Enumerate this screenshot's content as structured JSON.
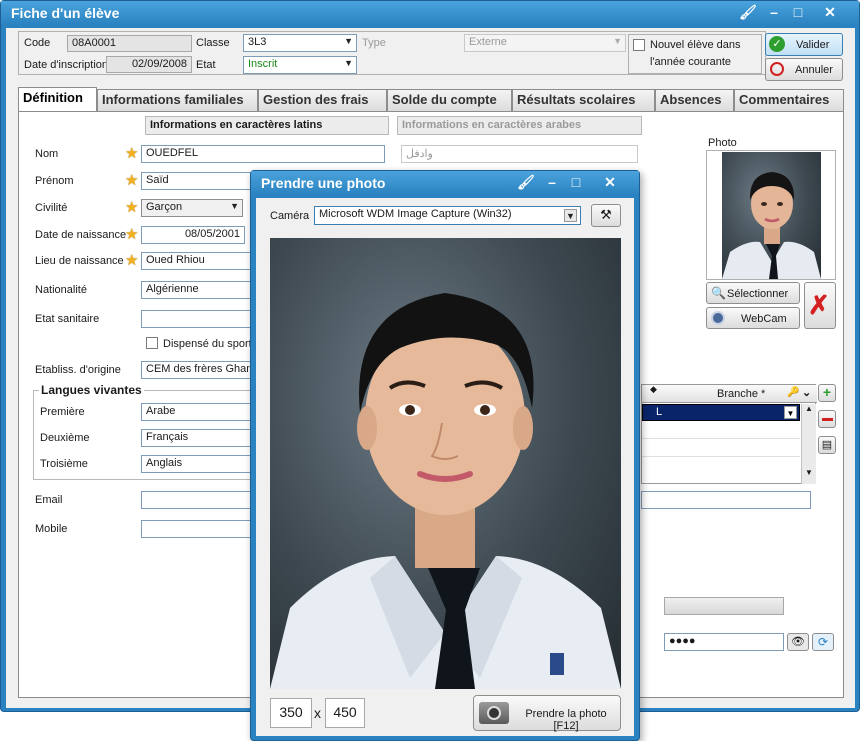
{
  "window": {
    "title": "Fiche d'un élève"
  },
  "header": {
    "code_label": "Code",
    "code_value": "08A0001",
    "classe_label": "Classe",
    "classe_value": "3L3",
    "type_label": "Type",
    "type_value": "Externe",
    "date_label": "Date d'inscription",
    "date_value": "02/09/2008",
    "etat_label": "Etat",
    "etat_value": "Inscrit",
    "nouvel_label_1": "Nouvel élève dans",
    "nouvel_label_2": "l'année courante",
    "valider": "Valider",
    "annuler": "Annuler"
  },
  "tabs": [
    "Définition",
    "Informations familiales",
    "Gestion des frais",
    "Solde du compte",
    "Résultats scolaires",
    "Absences",
    "Commentaires"
  ],
  "definition": {
    "latin_header": "Informations en caractères latins",
    "arabic_header": "Informations en caractères arabes",
    "nom_label": "Nom",
    "nom_value": "OUEDFEL",
    "nom_arabic": "وادفل",
    "prenom_label": "Prénom",
    "prenom_value": "Saïd",
    "civilite_label": "Civilité",
    "civilite_value": "Garçon",
    "dob_label": "Date de naissance",
    "dob_value": "08/05/2001",
    "lieu_label": "Lieu de naissance",
    "lieu_value": "Oued Rhiou",
    "nationalite_label": "Nationalité",
    "nationalite_value": "Algérienne",
    "etat_sanitaire_label": "Etat sanitaire",
    "sport_label": "Dispensé du sport",
    "etablissement_label": "Etabliss. d'origine",
    "etablissement_value": "CEM des frères Ghama",
    "langues_label": "Langues vivantes",
    "premiere_label": "Première",
    "premiere_value": "Arabe",
    "deuxieme_label": "Deuxième",
    "deuxieme_value": "Français",
    "troisieme_label": "Troisième",
    "troisieme_value": "Anglais",
    "email_label": "Email",
    "mobile_label": "Mobile",
    "photo_label": "Photo",
    "selectionner": "Sélectionner",
    "webcam": "WebCam",
    "branche_header": "Branche *",
    "branche_value": "L",
    "password_mask": "●●●●"
  },
  "dialog": {
    "title": "Prendre une photo",
    "camera_label": "Caméra",
    "camera_value": "Microsoft WDM Image Capture (Win32)",
    "width": "350",
    "times": "x",
    "height": "450",
    "capture_button": "Prendre la photo [F12]"
  },
  "colors": {
    "titlebar": "#2a82c0",
    "accent_star": "#f2b01e",
    "valid_green": "#2e9e2e",
    "cancel_red": "#d02020"
  }
}
